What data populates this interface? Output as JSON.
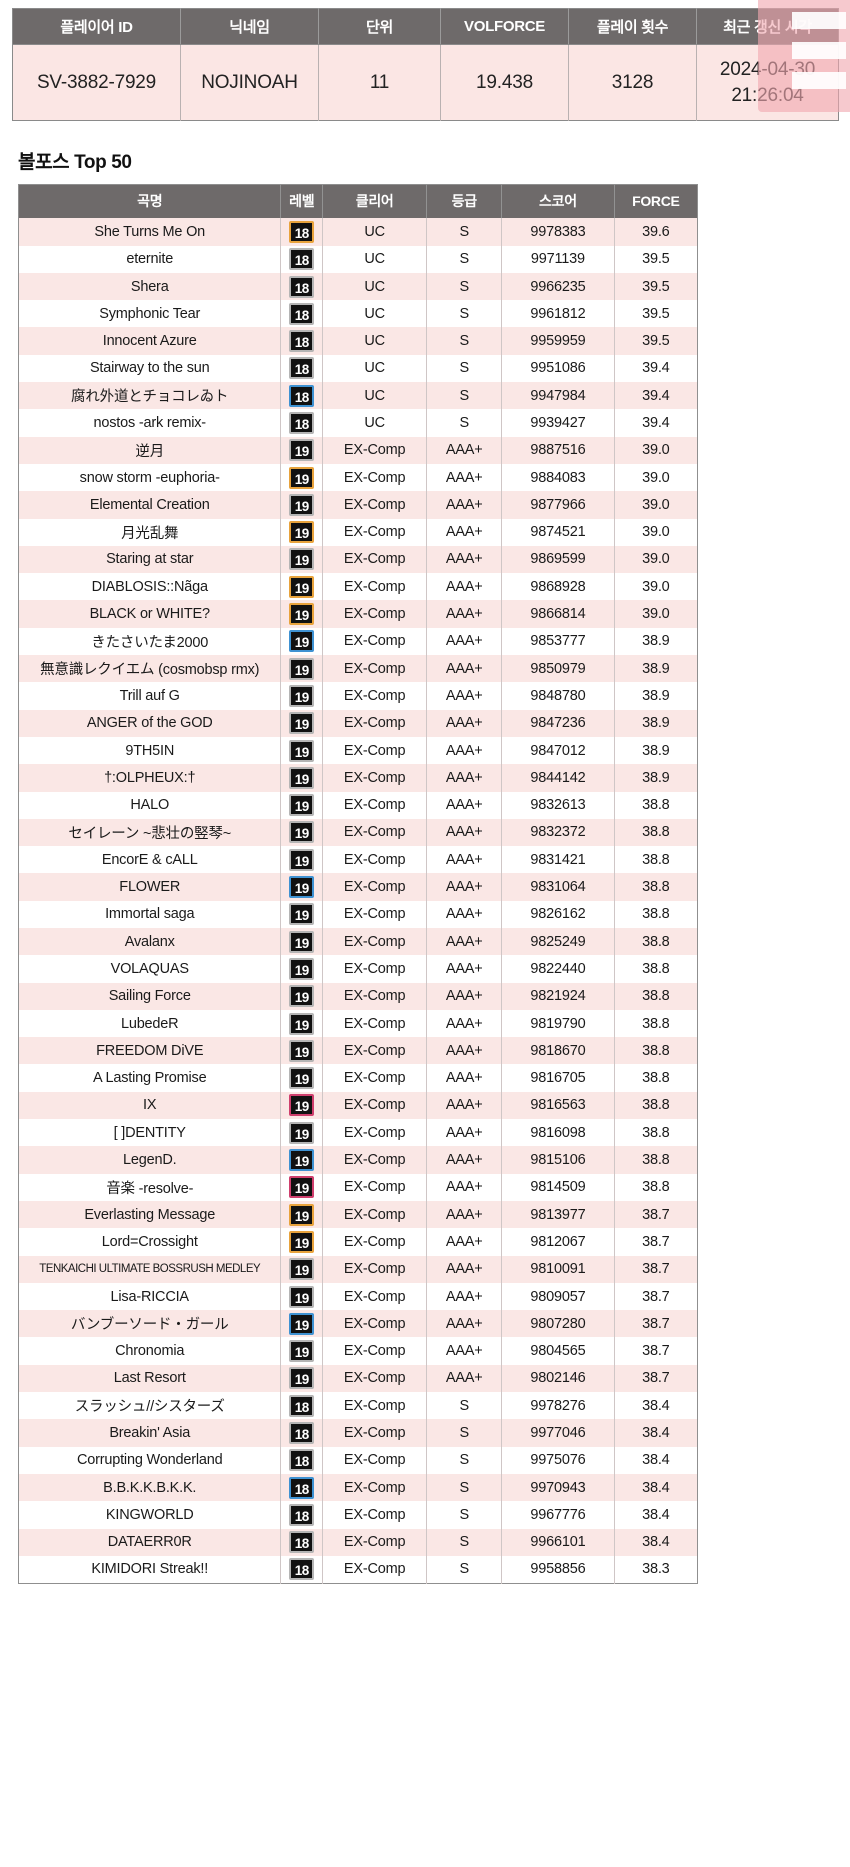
{
  "profile": {
    "headers": [
      "플레이어 ID",
      "닉네임",
      "단위",
      "VOLFORCE",
      "플레이 횟수",
      "최근 갱신 시각"
    ],
    "player_id": "SV-3882-7929",
    "nickname": "NOJINOAH",
    "rank_unit": "11",
    "volforce": "19.438",
    "play_count": "3128",
    "updated_date": "2024-04-30",
    "updated_time": "21:26:04"
  },
  "section": {
    "title": "볼포스 Top 50"
  },
  "top50": {
    "headers": [
      "곡명",
      "레벨",
      "클리어",
      "등급",
      "스코어",
      "FORCE"
    ],
    "rows": [
      {
        "title": "She Turns Me On",
        "level": "18",
        "badge": "orange",
        "clear": "UC",
        "grade": "S",
        "score": "9978383",
        "force": "39.6"
      },
      {
        "title": "eternite",
        "level": "18",
        "badge": "silver",
        "clear": "UC",
        "grade": "S",
        "score": "9971139",
        "force": "39.5"
      },
      {
        "title": "Shera",
        "level": "18",
        "badge": "silver",
        "clear": "UC",
        "grade": "S",
        "score": "9966235",
        "force": "39.5"
      },
      {
        "title": "Symphonic Tear",
        "level": "18",
        "badge": "silver",
        "clear": "UC",
        "grade": "S",
        "score": "9961812",
        "force": "39.5"
      },
      {
        "title": "Innocent Azure",
        "level": "18",
        "badge": "silver",
        "clear": "UC",
        "grade": "S",
        "score": "9959959",
        "force": "39.5"
      },
      {
        "title": "Stairway to the sun",
        "level": "18",
        "badge": "silver",
        "clear": "UC",
        "grade": "S",
        "score": "9951086",
        "force": "39.4"
      },
      {
        "title": "腐れ外道とチョコレゐト",
        "level": "18",
        "badge": "blue",
        "clear": "UC",
        "grade": "S",
        "score": "9947984",
        "force": "39.4"
      },
      {
        "title": "nostos -ark remix-",
        "level": "18",
        "badge": "silver",
        "clear": "UC",
        "grade": "S",
        "score": "9939427",
        "force": "39.4"
      },
      {
        "title": "逆月",
        "level": "19",
        "badge": "silver",
        "clear": "EX-Comp",
        "grade": "AAA+",
        "score": "9887516",
        "force": "39.0"
      },
      {
        "title": "snow storm -euphoria-",
        "level": "19",
        "badge": "orange",
        "clear": "EX-Comp",
        "grade": "AAA+",
        "score": "9884083",
        "force": "39.0"
      },
      {
        "title": "Elemental Creation",
        "level": "19",
        "badge": "silver",
        "clear": "EX-Comp",
        "grade": "AAA+",
        "score": "9877966",
        "force": "39.0"
      },
      {
        "title": "月光乱舞",
        "level": "19",
        "badge": "orange",
        "clear": "EX-Comp",
        "grade": "AAA+",
        "score": "9874521",
        "force": "39.0"
      },
      {
        "title": "Staring at star",
        "level": "19",
        "badge": "silver",
        "clear": "EX-Comp",
        "grade": "AAA+",
        "score": "9869599",
        "force": "39.0"
      },
      {
        "title": "DIABLOSIS::Nãga",
        "level": "19",
        "badge": "orange",
        "clear": "EX-Comp",
        "grade": "AAA+",
        "score": "9868928",
        "force": "39.0"
      },
      {
        "title": "BLACK or WHITE?",
        "level": "19",
        "badge": "orange",
        "clear": "EX-Comp",
        "grade": "AAA+",
        "score": "9866814",
        "force": "39.0"
      },
      {
        "title": "きたさいたま2000",
        "level": "19",
        "badge": "blue",
        "clear": "EX-Comp",
        "grade": "AAA+",
        "score": "9853777",
        "force": "38.9"
      },
      {
        "title": "無意識レクイエム (cosmobsp rmx)",
        "level": "19",
        "badge": "silver",
        "clear": "EX-Comp",
        "grade": "AAA+",
        "score": "9850979",
        "force": "38.9"
      },
      {
        "title": "Trill auf G",
        "level": "19",
        "badge": "silver",
        "clear": "EX-Comp",
        "grade": "AAA+",
        "score": "9848780",
        "force": "38.9"
      },
      {
        "title": "ANGER of the GOD",
        "level": "19",
        "badge": "silver",
        "clear": "EX-Comp",
        "grade": "AAA+",
        "score": "9847236",
        "force": "38.9"
      },
      {
        "title": "9TH5IN",
        "level": "19",
        "badge": "silver",
        "clear": "EX-Comp",
        "grade": "AAA+",
        "score": "9847012",
        "force": "38.9"
      },
      {
        "title": "†:OLPHEUX:†",
        "level": "19",
        "badge": "silver",
        "clear": "EX-Comp",
        "grade": "AAA+",
        "score": "9844142",
        "force": "38.9"
      },
      {
        "title": "HALO",
        "level": "19",
        "badge": "silver",
        "clear": "EX-Comp",
        "grade": "AAA+",
        "score": "9832613",
        "force": "38.8"
      },
      {
        "title": "セイレーン ~悲壮の竪琴~",
        "level": "19",
        "badge": "silver",
        "clear": "EX-Comp",
        "grade": "AAA+",
        "score": "9832372",
        "force": "38.8"
      },
      {
        "title": "EncorE & cALL",
        "level": "19",
        "badge": "silver",
        "clear": "EX-Comp",
        "grade": "AAA+",
        "score": "9831421",
        "force": "38.8"
      },
      {
        "title": "FLOWER",
        "level": "19",
        "badge": "blue",
        "clear": "EX-Comp",
        "grade": "AAA+",
        "score": "9831064",
        "force": "38.8"
      },
      {
        "title": "Immortal saga",
        "level": "19",
        "badge": "silver",
        "clear": "EX-Comp",
        "grade": "AAA+",
        "score": "9826162",
        "force": "38.8"
      },
      {
        "title": "Avalanx",
        "level": "19",
        "badge": "silver",
        "clear": "EX-Comp",
        "grade": "AAA+",
        "score": "9825249",
        "force": "38.8"
      },
      {
        "title": "VOLAQUAS",
        "level": "19",
        "badge": "silver",
        "clear": "EX-Comp",
        "grade": "AAA+",
        "score": "9822440",
        "force": "38.8"
      },
      {
        "title": "Sailing Force",
        "level": "19",
        "badge": "silver",
        "clear": "EX-Comp",
        "grade": "AAA+",
        "score": "9821924",
        "force": "38.8"
      },
      {
        "title": "LubedeR",
        "level": "19",
        "badge": "silver",
        "clear": "EX-Comp",
        "grade": "AAA+",
        "score": "9819790",
        "force": "38.8"
      },
      {
        "title": "FREEDOM DiVE",
        "level": "19",
        "badge": "silver",
        "clear": "EX-Comp",
        "grade": "AAA+",
        "score": "9818670",
        "force": "38.8"
      },
      {
        "title": "A Lasting Promise",
        "level": "19",
        "badge": "silver",
        "clear": "EX-Comp",
        "grade": "AAA+",
        "score": "9816705",
        "force": "38.8"
      },
      {
        "title": "IX",
        "level": "19",
        "badge": "crimson",
        "clear": "EX-Comp",
        "grade": "AAA+",
        "score": "9816563",
        "force": "38.8"
      },
      {
        "title": "[ ]DENTITY",
        "level": "19",
        "badge": "silver",
        "clear": "EX-Comp",
        "grade": "AAA+",
        "score": "9816098",
        "force": "38.8"
      },
      {
        "title": "LegenD.",
        "level": "19",
        "badge": "blue",
        "clear": "EX-Comp",
        "grade": "AAA+",
        "score": "9815106",
        "force": "38.8"
      },
      {
        "title": "音楽 -resolve-",
        "level": "19",
        "badge": "crimson",
        "clear": "EX-Comp",
        "grade": "AAA+",
        "score": "9814509",
        "force": "38.8"
      },
      {
        "title": "Everlasting Message",
        "level": "19",
        "badge": "orange",
        "clear": "EX-Comp",
        "grade": "AAA+",
        "score": "9813977",
        "force": "38.7"
      },
      {
        "title": "Lord=Crossight",
        "level": "19",
        "badge": "orange",
        "clear": "EX-Comp",
        "grade": "AAA+",
        "score": "9812067",
        "force": "38.7"
      },
      {
        "title": "TENKAICHI ULTIMATE BOSSRUSH MEDLEY",
        "level": "19",
        "badge": "silver",
        "clear": "EX-Comp",
        "grade": "AAA+",
        "score": "9810091",
        "force": "38.7",
        "small": true
      },
      {
        "title": "Lisa-RICCIA",
        "level": "19",
        "badge": "silver",
        "clear": "EX-Comp",
        "grade": "AAA+",
        "score": "9809057",
        "force": "38.7"
      },
      {
        "title": "バンブーソード・ガール",
        "level": "19",
        "badge": "blue",
        "clear": "EX-Comp",
        "grade": "AAA+",
        "score": "9807280",
        "force": "38.7"
      },
      {
        "title": "Chronomia",
        "level": "19",
        "badge": "silver",
        "clear": "EX-Comp",
        "grade": "AAA+",
        "score": "9804565",
        "force": "38.7"
      },
      {
        "title": "Last Resort",
        "level": "19",
        "badge": "silver",
        "clear": "EX-Comp",
        "grade": "AAA+",
        "score": "9802146",
        "force": "38.7"
      },
      {
        "title": "スラッシュ//シスターズ",
        "level": "18",
        "badge": "silver",
        "clear": "EX-Comp",
        "grade": "S",
        "score": "9978276",
        "force": "38.4"
      },
      {
        "title": "Breakin' Asia",
        "level": "18",
        "badge": "silver",
        "clear": "EX-Comp",
        "grade": "S",
        "score": "9977046",
        "force": "38.4"
      },
      {
        "title": "Corrupting Wonderland",
        "level": "18",
        "badge": "silver",
        "clear": "EX-Comp",
        "grade": "S",
        "score": "9975076",
        "force": "38.4"
      },
      {
        "title": "B.B.K.K.B.K.K.",
        "level": "18",
        "badge": "blue",
        "clear": "EX-Comp",
        "grade": "S",
        "score": "9970943",
        "force": "38.4"
      },
      {
        "title": "KINGWORLD",
        "level": "18",
        "badge": "silver",
        "clear": "EX-Comp",
        "grade": "S",
        "score": "9967776",
        "force": "38.4"
      },
      {
        "title": "DATAERR0R",
        "level": "18",
        "badge": "silver",
        "clear": "EX-Comp",
        "grade": "S",
        "score": "9966101",
        "force": "38.4"
      },
      {
        "title": "KIMIDORI Streak!!",
        "level": "18",
        "badge": "silver",
        "clear": "EX-Comp",
        "grade": "S",
        "score": "9958856",
        "force": "38.3"
      }
    ]
  }
}
